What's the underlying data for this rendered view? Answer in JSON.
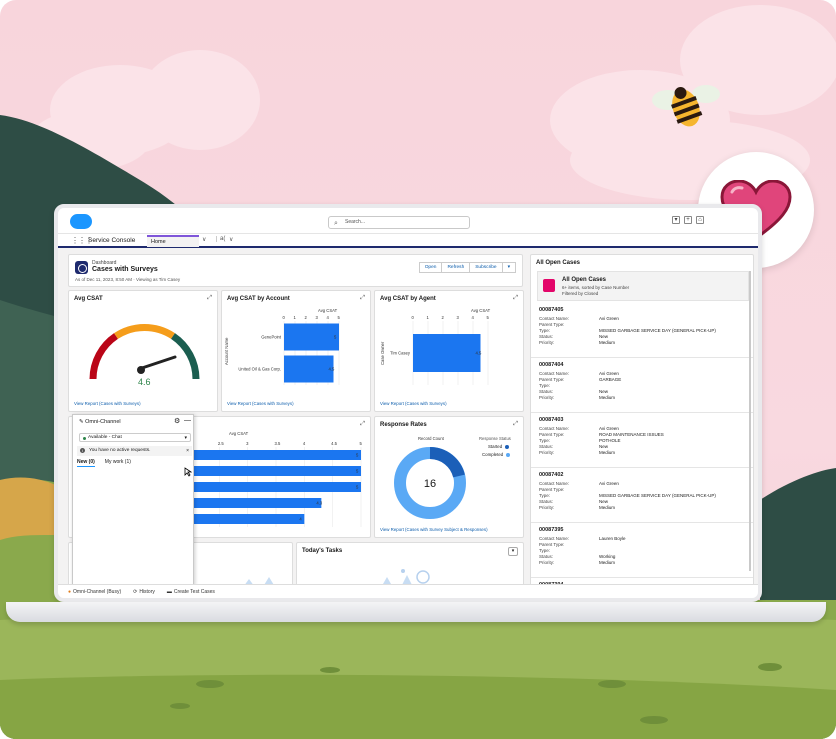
{
  "topbar": {
    "search_placeholder": "Search..."
  },
  "nav": {
    "app_name": "Service Console",
    "tab_home": "Home",
    "tab_dropdown": "∨",
    "tab_extra": "a(",
    "tab_extra_caret": "∨"
  },
  "dashboard": {
    "type_label": "Dashboard",
    "title": "Cases with Surveys",
    "subtitle": "As of Dec 11, 2023, 8:50 AM · Viewing as Tim Casey",
    "buttons": [
      "Open",
      "Refresh",
      "Subscribe",
      "▾"
    ]
  },
  "cards": {
    "avg_csat": {
      "title": "Avg CSAT",
      "value": "4.6",
      "link": "View Report (Cases with Surveys)"
    },
    "csat_by_account": {
      "title": "Avg CSAT by Account",
      "axis_title": "Avg CSAT",
      "y_title": "Account Name",
      "ticks": [
        "0",
        "1",
        "2",
        "3",
        "4",
        "5"
      ],
      "link": "View Report (Cases with Surveys)"
    },
    "csat_by_agent": {
      "title": "Avg CSAT by Agent",
      "axis_title": "Avg CSAT",
      "y_title": "Case Owner",
      "ticks": [
        "0",
        "1",
        "2",
        "3",
        "4",
        "5"
      ],
      "link": "View Report (Cases with Surveys)"
    },
    "avg_csat_bars": {
      "axis_title": "Avg CSAT",
      "ticks": [
        "2",
        "2.5",
        "3",
        "3.5",
        "4",
        "4.5",
        "5"
      ]
    },
    "response_rates": {
      "title": "Response Rates",
      "center_value": "16",
      "count_label": "Record Count",
      "legend_title": "Response Status",
      "legend": [
        "Started",
        "Completed"
      ],
      "link": "View Report (Cases with Survey Subject & Responses)"
    },
    "todays_tasks": {
      "title": "Today's Tasks",
      "menu": "▾"
    }
  },
  "chart_data": [
    {
      "type": "bar",
      "title": "Avg CSAT by Account",
      "xlabel": "Avg CSAT",
      "ylabel": "Account Name",
      "categories": [
        "GenePoint",
        "United Oil & Gas Corp."
      ],
      "values": [
        5,
        4.5
      ],
      "value_labels": [
        "5",
        "4.5"
      ],
      "xlim": [
        0,
        6
      ]
    },
    {
      "type": "bar",
      "title": "Avg CSAT by Agent",
      "xlabel": "Avg CSAT",
      "ylabel": "Case Owner",
      "categories": [
        "Tim Casey"
      ],
      "values": [
        4.5
      ],
      "value_labels": [
        "4.5"
      ],
      "xlim": [
        0,
        6
      ]
    },
    {
      "type": "bar",
      "xlabel": "Avg CSAT",
      "values": [
        5,
        5,
        5,
        4.3,
        4
      ],
      "value_labels": [
        "5",
        "5",
        "5",
        "4.3",
        "4"
      ],
      "xlim": [
        2,
        5
      ]
    },
    {
      "type": "pie",
      "title": "Response Rates",
      "categories": [
        "Started",
        "Completed"
      ],
      "colors": [
        "#1b5fb8",
        "#5aa9f5"
      ]
    }
  ],
  "omni": {
    "title": "Omni-Channel",
    "status": "Available - Chat",
    "note": "You have no active requests.",
    "tab_new": "New (0)",
    "tab_mywork": "My work (1)"
  },
  "footer": {
    "omni": "Omni-Channel (Busy)",
    "history": "History",
    "create": "Create Test Cases"
  },
  "open_cases": {
    "panel_title": "All Open Cases",
    "header_title": "All Open Cases",
    "header_sub1": "6+ items, sorted by Case Number",
    "header_sub2": "Filtered by Closed",
    "field_labels": [
      "Contact Name:",
      "Parent Type:",
      "Type:",
      "Status:",
      "Priority:"
    ],
    "cases": [
      {
        "number": "00087405",
        "values": [
          "Avi Green",
          "",
          "MISSED GARBAGE SERVICE DAY (GENERAL PICK-UP)",
          "New",
          "Medium"
        ]
      },
      {
        "number": "00087404",
        "values": [
          "Avi Green",
          "GARBAGE",
          "",
          "New",
          "Medium"
        ]
      },
      {
        "number": "00087403",
        "values": [
          "Avi Green",
          "ROAD MAINTENANCE ISSUES",
          "POTHOLE",
          "New",
          "Medium"
        ]
      },
      {
        "number": "00087402",
        "values": [
          "Avi Green",
          "",
          "MISSED GARBAGE SERVICE DAY (GENERAL PICK-UP)",
          "New",
          "Medium"
        ]
      },
      {
        "number": "00087395",
        "values": [
          "Lauren Boyle",
          "",
          "",
          "Working",
          "Medium"
        ]
      },
      {
        "number": "00087394",
        "values": [
          "",
          "",
          "",
          "",
          ""
        ]
      }
    ]
  },
  "colors": {
    "accent": "#1b96ff",
    "navy": "#1e2a6e",
    "bar": "#1b76f0",
    "heart": "#e0457b"
  }
}
